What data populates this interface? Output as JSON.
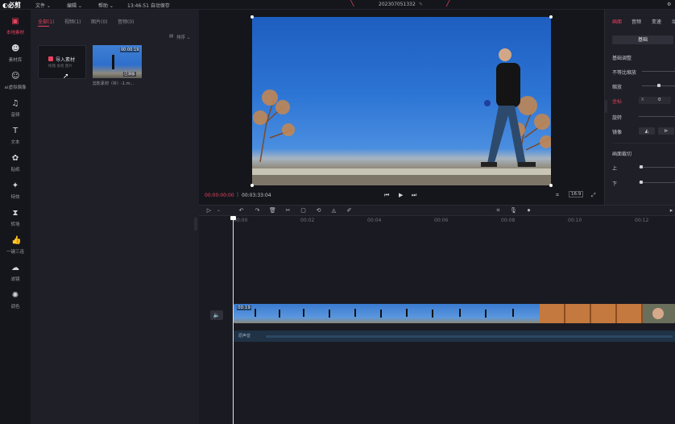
{
  "topbar": {
    "menu_file": "文件 ⌄",
    "menu_edit": "编辑 ⌄",
    "menu_help": "帮助 ⌄",
    "autosave": "13:46:51 自动保存",
    "project_name": "202307051332"
  },
  "sidebar": {
    "items": [
      {
        "label": "本地素材",
        "icon": "media-icon"
      },
      {
        "label": "素材库",
        "icon": "library-icon"
      },
      {
        "label": "ai虚拟偶像",
        "icon": "robot-icon"
      },
      {
        "label": "音频",
        "icon": "music-icon"
      },
      {
        "label": "文本",
        "icon": "text-icon"
      },
      {
        "label": "贴纸",
        "icon": "sticker-icon"
      },
      {
        "label": "特效",
        "icon": "effects-icon"
      },
      {
        "label": "转场",
        "icon": "transition-icon"
      },
      {
        "label": "一键三连",
        "icon": "thumbs-up-icon"
      },
      {
        "label": "滤镜",
        "icon": "filter-icon"
      },
      {
        "label": "调色",
        "icon": "palette-icon"
      }
    ]
  },
  "media": {
    "tabs": [
      "全部(1)",
      "视频(1)",
      "图片(0)",
      "音频(0)"
    ],
    "sort_label": "排序 ⌄",
    "import_label": "导入素材",
    "import_sub": "拖拽 会视 图片",
    "clip_duration": "00:00:19",
    "clip_badge": "已添加",
    "clip_name": "剪影素材（补）-1.m..."
  },
  "player": {
    "current_time": "00:00:00:00",
    "total_time": "00:03:33:04",
    "ratio": "16:9"
  },
  "props": {
    "tabs": [
      "画面",
      "音频",
      "变速",
      "动"
    ],
    "basic_btn": "基础",
    "section_basic": "基础调整",
    "uniform_scale": "不等比缩放",
    "scale": "缩放",
    "position": "坐标",
    "position_value": "0",
    "rotate": "旋转",
    "mirror": "镜像",
    "section_crop": "画面裁切",
    "crop_top": "上",
    "crop_bottom": "下"
  },
  "timeline": {
    "ticks": [
      "00:00",
      "00:02",
      "00:04",
      "00:06",
      "00:08",
      "00:10",
      "00:12"
    ],
    "clip_label": "00:19",
    "audio_label": "原声音"
  }
}
